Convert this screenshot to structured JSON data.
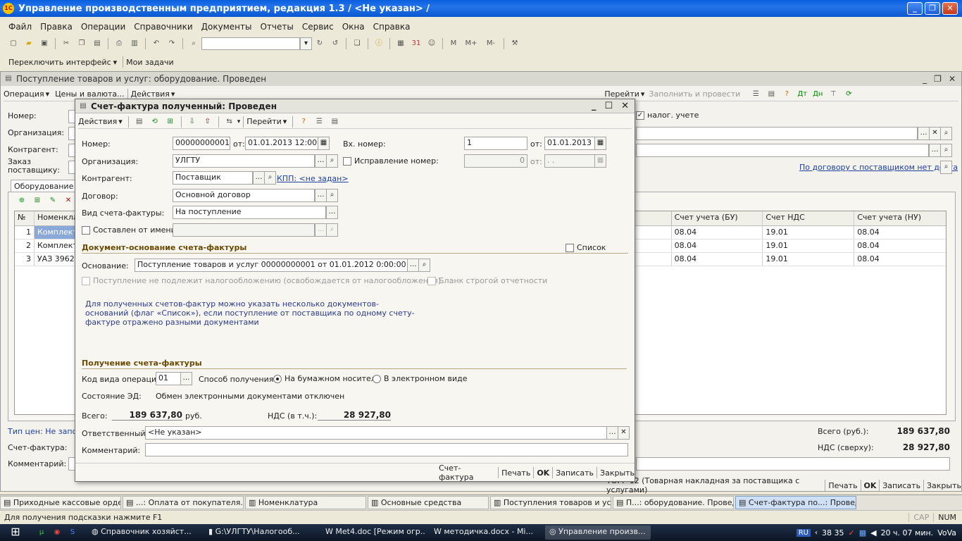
{
  "app": {
    "title": "Управление производственным предприятием, редакция 1.3 / <Не указан> /"
  },
  "menu": [
    "Файл",
    "Правка",
    "Операции",
    "Справочники",
    "Документы",
    "Отчеты",
    "Сервис",
    "Окна",
    "Справка"
  ],
  "toolbar2": {
    "switch_interface": "Переключить интерфейс",
    "my_tasks": "Мои задачи"
  },
  "doc": {
    "title": "Поступление товаров и услуг: оборудование. Проведен",
    "toolbar": {
      "operation": "Операция",
      "prices": "Цены и валюта...",
      "actions": "Действия",
      "goto": "Перейти",
      "fill_post": "Заполнить и провести"
    },
    "labels": {
      "number": "Номер:",
      "org": "Организация:",
      "contractor": "Контрагент:",
      "order": "Заказ поставщику:"
    },
    "tax_accounting": "налог. учете",
    "no_contract_link": "По договору с поставщиком нет долга",
    "tab": "Оборудование (3",
    "grid": {
      "columns": [
        "№",
        "Номенкла",
        "Счет учета (БУ)",
        "Счет НДС",
        "Счет учета (НУ)"
      ],
      "rows": [
        {
          "n": "1",
          "name": "Комплект",
          "bu": "08.04",
          "vat": "19.01",
          "nu": "08.04"
        },
        {
          "n": "2",
          "name": "Комплект",
          "bu": "08.04",
          "vat": "19.01",
          "nu": "08.04"
        },
        {
          "n": "3",
          "name": "УАЗ 39625",
          "bu": "08.04",
          "vat": "19.01",
          "nu": "08.04"
        }
      ]
    },
    "price_type": "Тип цен: Не запол",
    "invoice_label": "Счет-фактура:",
    "comment_label": "Комментарий:",
    "total_label": "Всего (руб.):",
    "total": "189 637,80",
    "vat_label": "НДС (сверху):",
    "vat": "28 927,80",
    "footer": {
      "torg": "ТОРГ-12 (Товарная накладная за поставщика с услугами)",
      "print": "Печать",
      "ok": "OK",
      "save": "Записать",
      "close": "Закрыть"
    }
  },
  "dialog": {
    "title": "Счет-фактура полученный: Проведен",
    "toolbar": {
      "actions": "Действия",
      "goto": "Перейти"
    },
    "number_label": "Номер:",
    "number": "00000000001",
    "from_label": "от:",
    "date": "01.01.2013 12:00:00",
    "in_number_label": "Вх. номер:",
    "in_number": "1",
    "in_date": "01.01.2013",
    "org_label": "Организация:",
    "org": "УЛГТУ",
    "correction_label": "Исправление номер:",
    "correction_num": "0",
    "correction_date": " .  .",
    "contractor_label": "Контрагент:",
    "contractor": "Поставщик",
    "kpp_link": "КПП: <не задан>",
    "contract_label": "Договор:",
    "contract": "Основной договор",
    "invoice_type_label": "Вид счета-фактуры:",
    "invoice_type": "На поступление",
    "composed_label": "Составлен от имени:",
    "basis_section": "Документ-основание счета-фактуры",
    "list_label": "Список",
    "basis_label": "Основание:",
    "basis": "Поступление товаров и услуг 00000000001 от 01.01.2012 0:00:00",
    "not_taxable": "Поступление не подлежит налогообложению (освобождается от налогообложения)",
    "strict_form": "Бланк строгой отчетности",
    "note": "Для полученных счетов-фактур можно указать несколько документов-оснований (флаг «Список»), если поступление от поставщика по одному счету-фактуре отражено разными документами",
    "receive_section": "Получение счета-фактуры",
    "op_code_label": "Код вида операции:",
    "op_code": "01",
    "method_label": "Способ получения:",
    "method_paper": "На бумажном носителе",
    "method_electronic": "В электронном виде",
    "ed_state_label": "Состояние ЭД:",
    "ed_state": "Обмен электронными документами отключен",
    "total_label": "Всего:",
    "total": "189 637,80",
    "currency": "руб.",
    "vat_label": "НДС (в т.ч.):",
    "vat": "28 927,80",
    "responsible_label": "Ответственный:",
    "responsible": "<Не указан>",
    "comment_label": "Комментарий:",
    "footer": {
      "invoice": "Счет-фактура",
      "print": "Печать",
      "ok": "OK",
      "save": "Записать",
      "close": "Закрыть"
    }
  },
  "windows_bar": [
    "Приходные кассовые ордера",
    "...: Оплата от покупателя. П...",
    "Номенклатура",
    "Основные средства",
    "Поступления товаров и услуг",
    "П...: оборудование. Проведен",
    "Счет-фактура по...: Проведен"
  ],
  "status": {
    "hint": "Для получения подсказки нажмите F1",
    "cap": "CAP",
    "num": "NUM"
  },
  "taskbar": {
    "tasks": [
      "Справочник хозяйст...",
      "G:\\УЛГТУ\\Налогооб...",
      "Met4.doc [Режим огр...",
      "методичка.docx - Mi...",
      "Управление произв..."
    ],
    "lang": "RU",
    "clock": "20 ч. 07 мин.",
    "user": "VoVa",
    "indicator": "38 35"
  }
}
